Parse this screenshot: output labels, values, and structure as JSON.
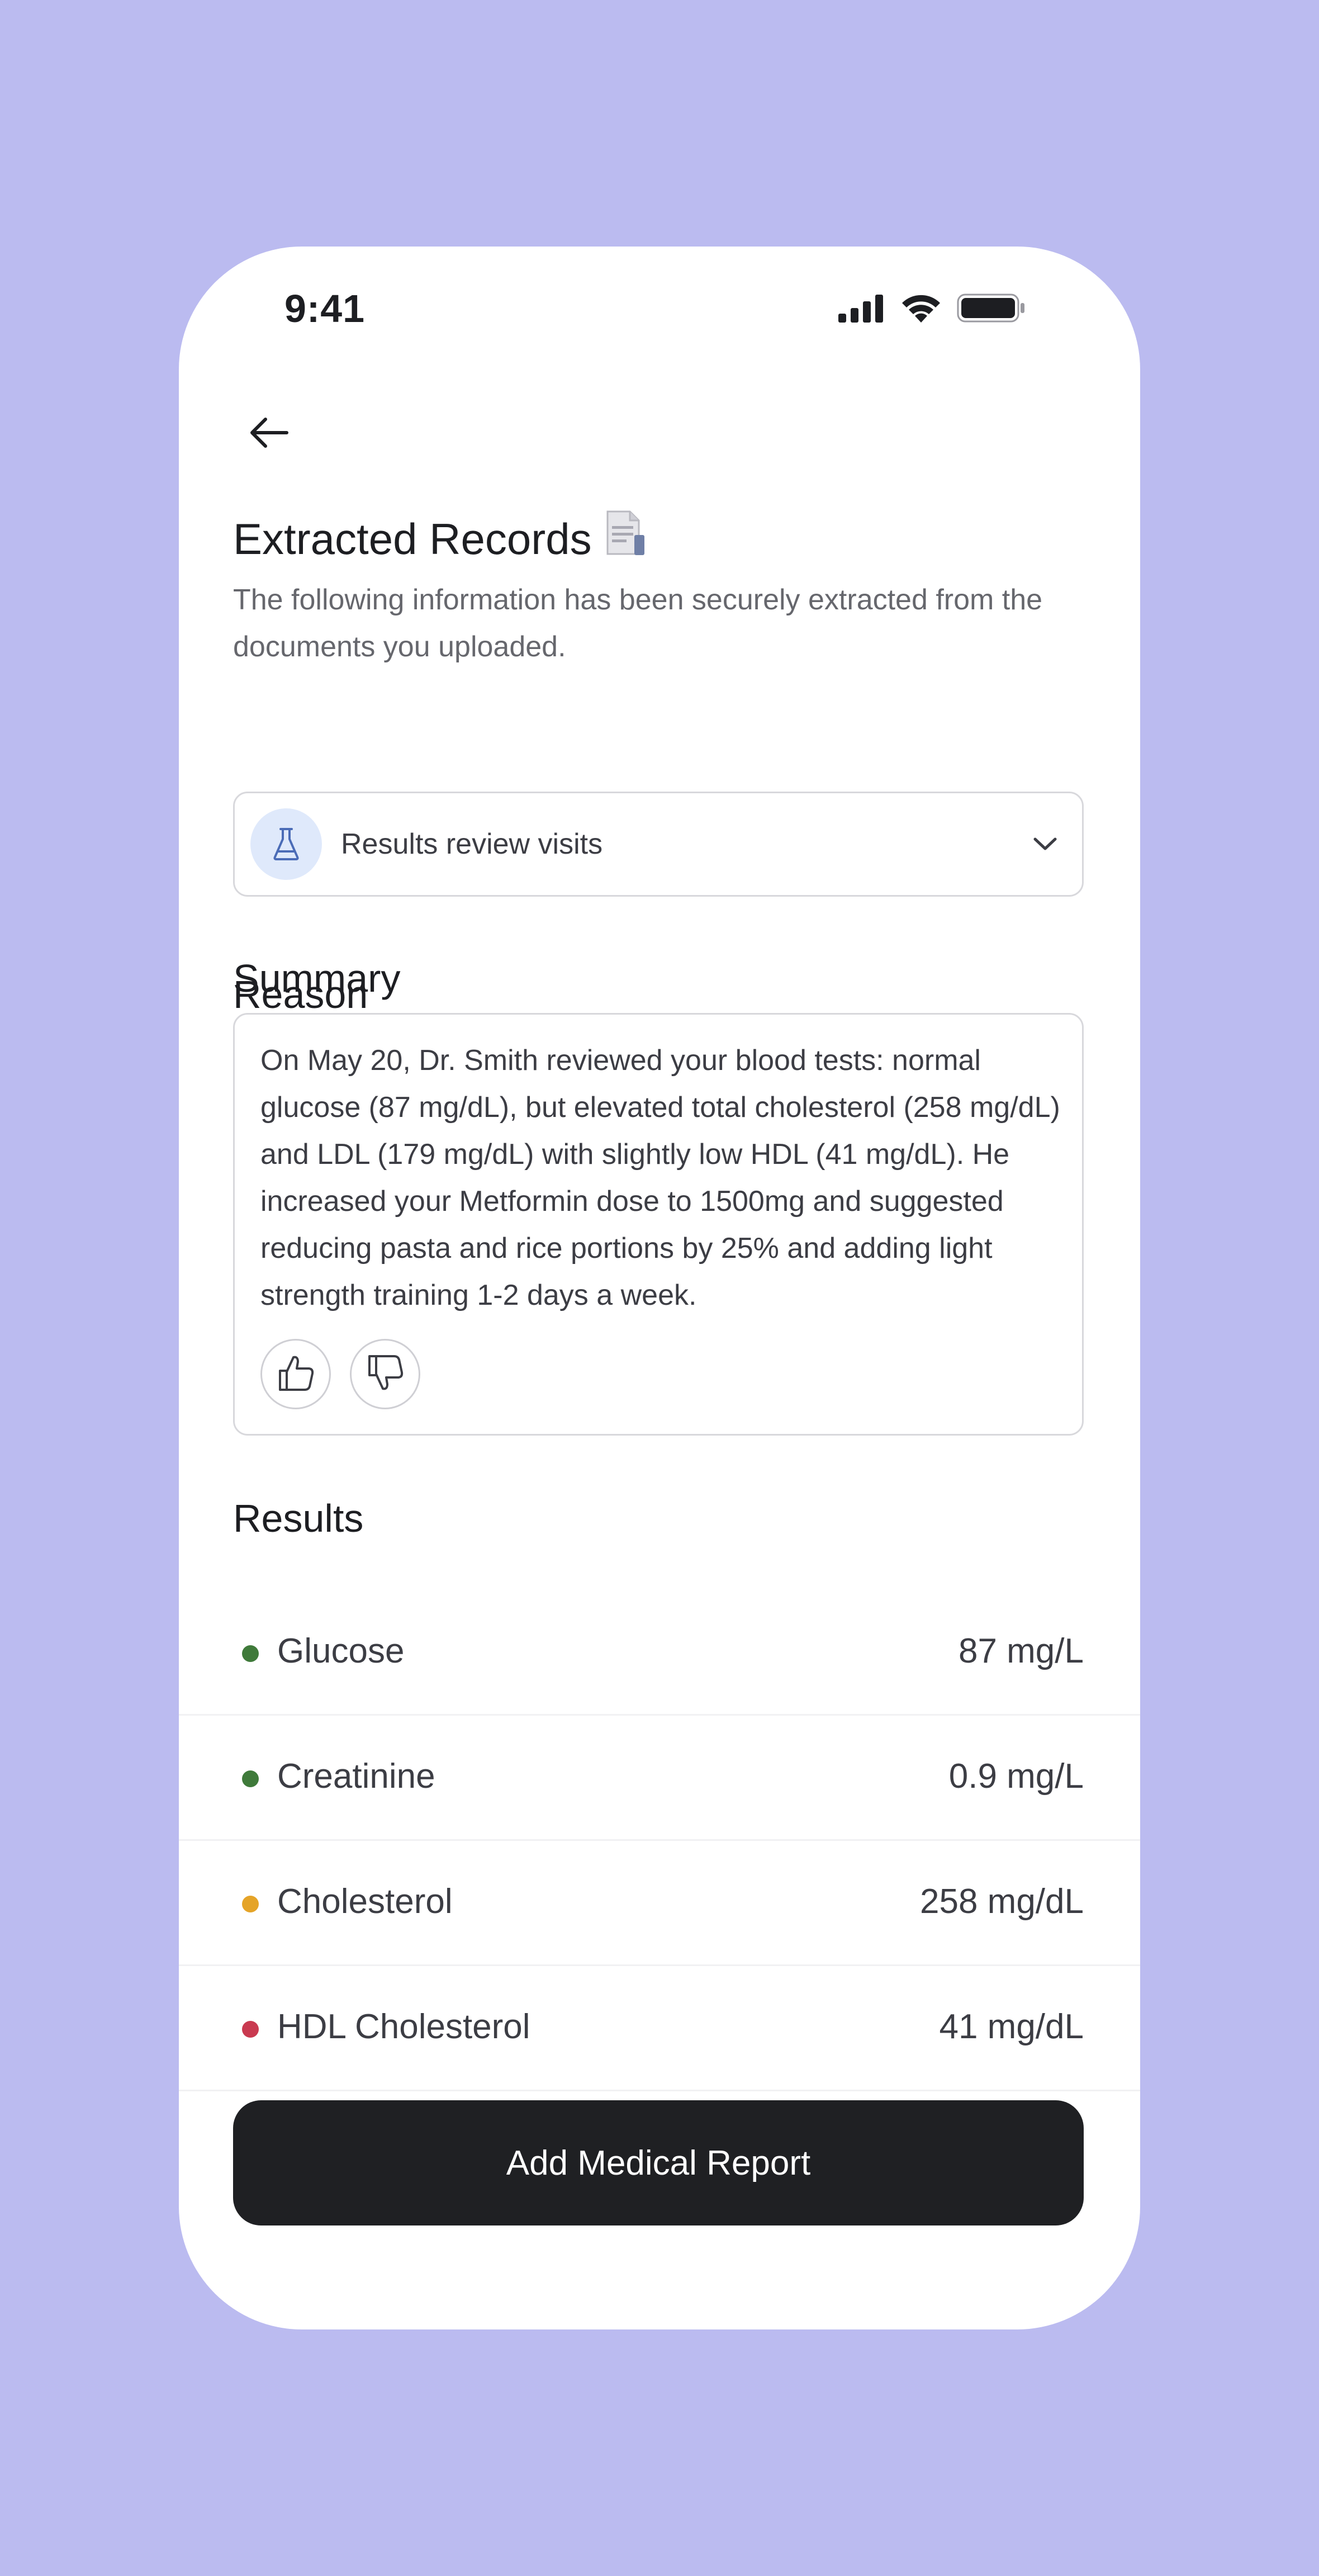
{
  "status_bar": {
    "time": "9:41",
    "icons": [
      "cellular-signal-icon",
      "wifi-icon",
      "battery-icon"
    ]
  },
  "nav": {
    "back_icon": "arrow-left-icon"
  },
  "header": {
    "title": "Extracted Records",
    "title_icon": "document-icon",
    "subtitle": "The following information has been securely extracted from the documents you uploaded."
  },
  "reason": {
    "heading": "Reason",
    "icon": "flask-icon",
    "selected": "Results review visits",
    "dropdown_icon": "chevron-down-icon"
  },
  "summary": {
    "heading": "Summary",
    "text": "On May 20, Dr. Smith reviewed your blood tests: normal glucose (87 mg/dL), but elevated total cholesterol (258 mg/dL) and LDL (179 mg/dL) with slightly low HDL (41 mg/dL). He increased your Metformin dose to 1500mg and suggested reducing pasta and rice portions by 25% and adding light strength training 1-2 days a week.",
    "feedback": [
      "thumbs-up-icon",
      "thumbs-down-icon"
    ]
  },
  "results": {
    "heading": "Results",
    "items": [
      {
        "name": "Glucose",
        "value": "87 mg/L",
        "status_color": "#3f7a3a"
      },
      {
        "name": "Creatinine",
        "value": "0.9 mg/L",
        "status_color": "#3f7a3a"
      },
      {
        "name": "Cholesterol",
        "value": "258 mg/dL",
        "status_color": "#e5a428"
      },
      {
        "name": "HDL Cholesterol",
        "value": "41 mg/dL",
        "status_color": "#c93a50"
      }
    ]
  },
  "actions": {
    "primary_label": "Add Medical Report"
  },
  "colors": {
    "background": "#bbbbf0",
    "card": "#ffffff",
    "primary_button": "#1f2023",
    "reason_icon_bg": "#dfe9fb"
  }
}
